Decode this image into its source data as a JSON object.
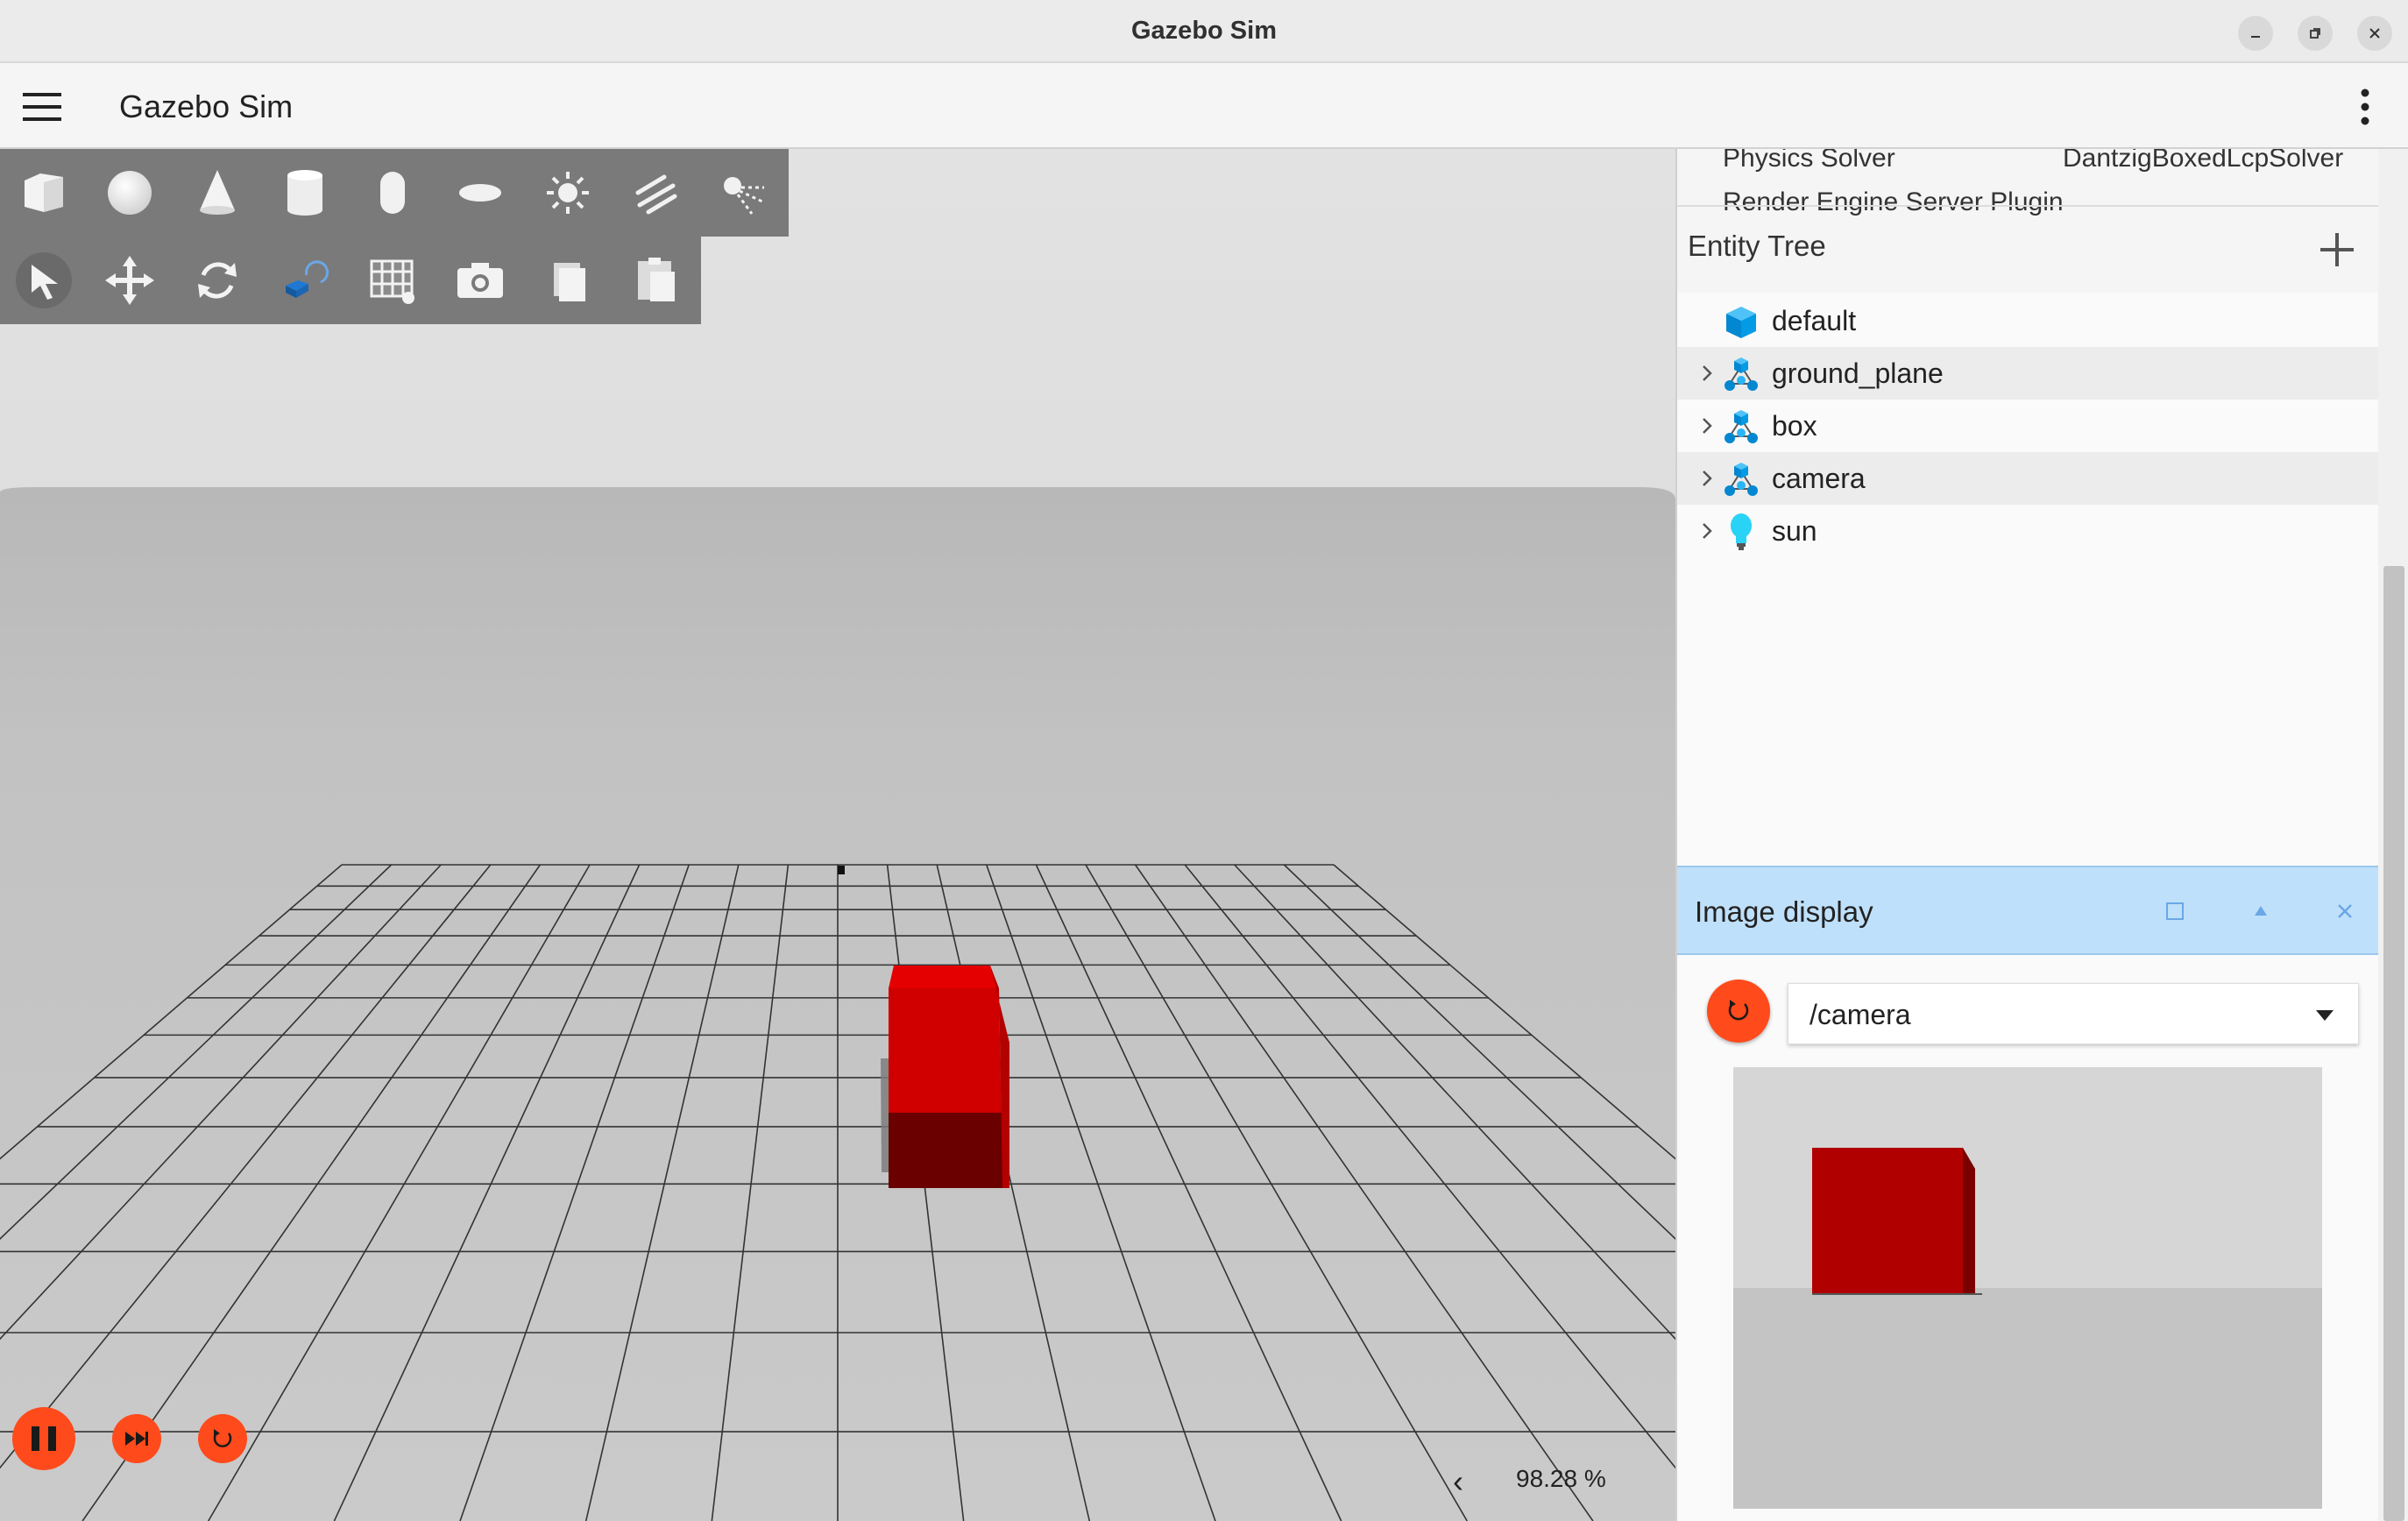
{
  "window": {
    "title": "Gazebo Sim",
    "controls": [
      "minimize",
      "maximize",
      "close"
    ]
  },
  "app": {
    "title": "Gazebo Sim",
    "menu_icon": "hamburger-menu-icon",
    "options_icon": "kebab-menu-icon"
  },
  "shape_toolbar": {
    "tools": [
      "box",
      "sphere",
      "cone",
      "cylinder",
      "capsule",
      "ellipsoid",
      "point-light",
      "directional-light",
      "spot-light"
    ]
  },
  "tool_toolbar": {
    "tools": [
      "select",
      "translate",
      "rotate",
      "transform-control",
      "grid-snap",
      "screenshot",
      "copy",
      "paste"
    ],
    "active": "select"
  },
  "world_properties": {
    "rows": [
      {
        "label": "Physics Solver",
        "value": "DantzigBoxedLcpSolver"
      },
      {
        "label": "Render Engine Server Plugin",
        "value": ""
      }
    ]
  },
  "entity_tree": {
    "title": "Entity Tree",
    "items": [
      {
        "label": "default",
        "icon": "world-cube-icon",
        "expandable": false
      },
      {
        "label": "ground_plane",
        "icon": "model-icon",
        "expandable": true
      },
      {
        "label": "box",
        "icon": "model-icon",
        "expandable": true
      },
      {
        "label": "camera",
        "icon": "model-icon",
        "expandable": true
      },
      {
        "label": "sun",
        "icon": "light-bulb-icon",
        "expandable": true
      }
    ]
  },
  "image_display": {
    "title": "Image display",
    "topic": "/camera"
  },
  "playback": {
    "buttons": [
      "pause",
      "step",
      "reset"
    ],
    "real_time_factor": "98.28 %"
  },
  "colors": {
    "accent": "#ff4a1c",
    "plugin_header": "#bfe0fa",
    "box_red": "#d40000",
    "toolbar_gray": "#7a7a7a"
  }
}
